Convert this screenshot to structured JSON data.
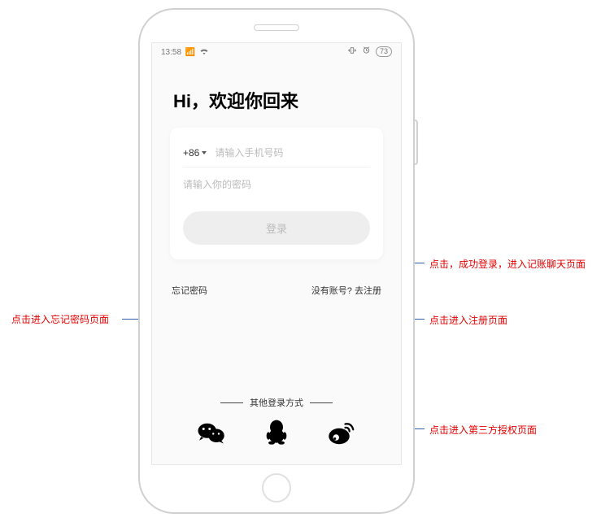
{
  "status": {
    "time": "13:58",
    "battery": "73"
  },
  "title": "Hi，欢迎你回来",
  "form": {
    "country_code": "+86",
    "phone_placeholder": "请输入手机号码",
    "password_placeholder": "请输入你的密码",
    "login_label": "登录"
  },
  "links": {
    "forgot": "忘记密码",
    "no_account": "没有账号?",
    "register": "去注册"
  },
  "other": {
    "title": "其他登录方式"
  },
  "annotations": {
    "login_btn": "点击，成功登录，进入记账聊天页面",
    "register": "点击进入注册页面",
    "forgot": "点击进入忘记密码页面",
    "weibo": "点击进入第三方授权页面"
  }
}
